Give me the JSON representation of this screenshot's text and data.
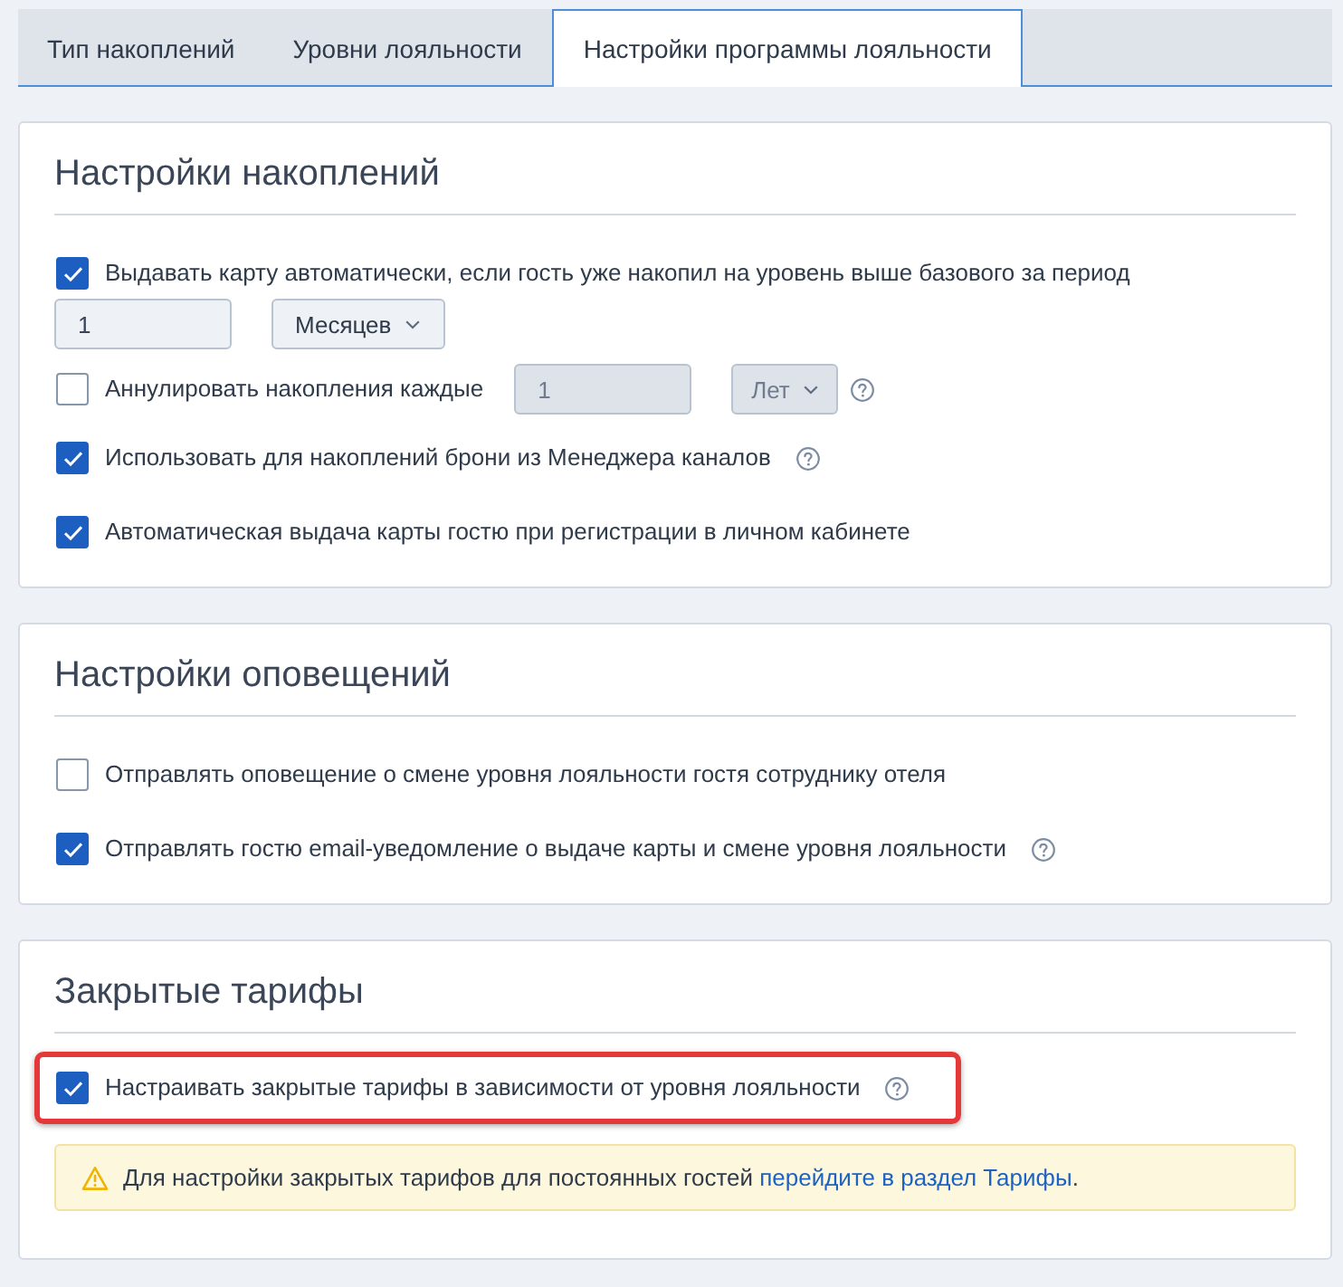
{
  "tabs": [
    {
      "label": "Тип накоплений",
      "selected": false
    },
    {
      "label": "Уровни лояльности",
      "selected": false
    },
    {
      "label": "Настройки программы лояльности",
      "selected": true
    }
  ],
  "sections": [
    {
      "title": "Настройки накоплений",
      "rows": [
        {
          "kind": "option",
          "label": "Выдавать карту автоматически, если гость уже накопил на уровень выше базового за период",
          "checked": true,
          "help": false,
          "highlighted": false
        },
        {
          "kind": "controls",
          "controls": [
            {
              "kind": "input",
              "value": "1",
              "disabled": false
            },
            {
              "kind": "select",
              "value": "Месяцев",
              "disabled": false
            }
          ]
        },
        {
          "kind": "option",
          "label": "Аннулировать накопления каждые",
          "checked": false,
          "controls": [
            {
              "kind": "input",
              "value": "1",
              "disabled": true
            },
            {
              "kind": "select",
              "value": "Лет",
              "disabled": true
            }
          ],
          "help": true,
          "highlighted": false
        },
        {
          "kind": "option",
          "label": "Использовать для накоплений брони из Менеджера каналов",
          "checked": true,
          "help": true,
          "highlighted": false
        },
        {
          "kind": "option",
          "label": "Автоматическая выдача карты гостю при регистрации в личном кабинете",
          "checked": true,
          "help": false,
          "highlighted": false
        }
      ]
    },
    {
      "title": "Настройки оповещений",
      "rows": [
        {
          "kind": "option",
          "label": "Отправлять оповещение о смене уровня лояльности гостя сотруднику отеля",
          "checked": false,
          "help": false,
          "highlighted": false
        },
        {
          "kind": "option",
          "label": "Отправлять гостю email-уведомление о выдаче карты и смене уровня лояльности",
          "checked": true,
          "help": true,
          "highlighted": false
        }
      ]
    },
    {
      "title": "Закрытые тарифы",
      "rows": [
        {
          "kind": "option",
          "label": "Настраивать закрытые тарифы в зависимости от уровня лояльности",
          "checked": true,
          "help": true,
          "highlighted": true
        },
        {
          "kind": "notice",
          "text": "Для настройки закрытых тарифов для постоянных гостей",
          "link": "перейдите в раздел Тарифы",
          "end": "."
        }
      ]
    }
  ]
}
